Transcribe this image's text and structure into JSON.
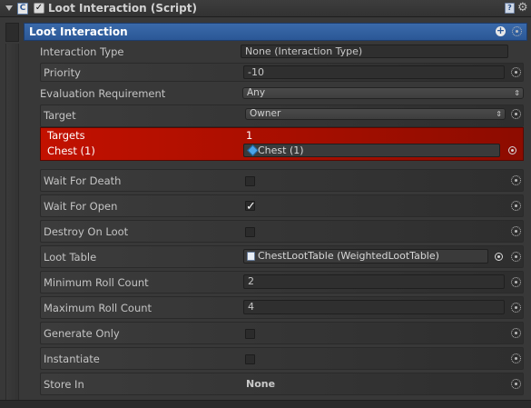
{
  "component": {
    "title": "Loot Interaction (Script)",
    "enabled": true,
    "script_icon_letter": "C",
    "help_icon_letter": "?",
    "settings_glyph": "⚙"
  },
  "section": {
    "title": "Loot Interaction",
    "add_glyph": "+"
  },
  "fields": {
    "interaction_type": {
      "label": "Interaction Type",
      "value": "None (Interaction Type)"
    },
    "priority": {
      "label": "Priority",
      "value": "-10"
    },
    "evaluation_requirement": {
      "label": "Evaluation Requirement",
      "value": "Any"
    },
    "target": {
      "label": "Target",
      "value": "Owner"
    },
    "targets": {
      "label": "Targets",
      "value": "1"
    },
    "chest": {
      "label": "Chest (1)",
      "value": "Chest (1)"
    },
    "wait_for_death": {
      "label": "Wait For Death",
      "checked": false
    },
    "wait_for_open": {
      "label": "Wait For Open",
      "checked": true,
      "checkmark": "✓"
    },
    "destroy_on_loot": {
      "label": "Destroy On Loot",
      "checked": false
    },
    "loot_table": {
      "label": "Loot Table",
      "value": "ChestLootTable (WeightedLootTable)"
    },
    "minimum_roll_count": {
      "label": "Minimum Roll Count",
      "value": "2"
    },
    "maximum_roll_count": {
      "label": "Maximum Roll Count",
      "value": "4"
    },
    "generate_only": {
      "label": "Generate Only",
      "checked": false
    },
    "instantiate": {
      "label": "Instantiate",
      "checked": false
    },
    "store_in": {
      "label": "Store In",
      "value": "None"
    }
  },
  "icons": {
    "dropdown_arrows": "⇕",
    "dropdown_arrow_single": "▾"
  },
  "colors": {
    "section_header": "#2b5796",
    "target_highlight": "#b10f00"
  }
}
